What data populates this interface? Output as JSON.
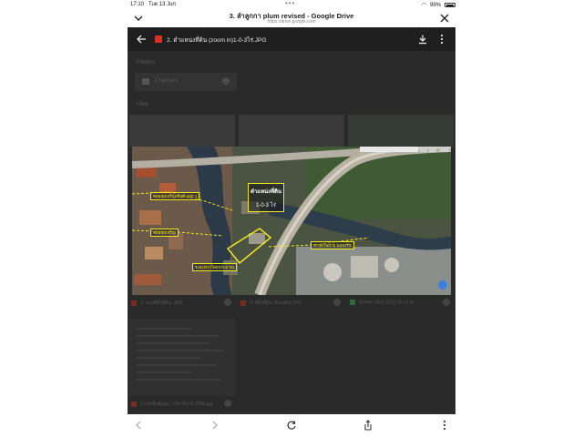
{
  "status_bar": {
    "time": "17:10",
    "date": "Tue 13 Jun",
    "battery": "99%"
  },
  "browser": {
    "title": "3. ลำลูกกา plum revised - Google Drive",
    "url": "https://drive.google.com"
  },
  "viewer": {
    "file_name": "2. ตำแหน่งที่ดิน (zoom in)1-0-3ไร่.JPG"
  },
  "background": {
    "folders_label": "Folders",
    "folder_name": "Channels",
    "files_label": "Files",
    "captions": [
      "1. แผนที่ตั้งที่ดิน .JPG",
      "2. ที่ตั้งที่ดิน (ซ้อนทับ) JPG",
      "Screen Shot 2023-06-15 at"
    ],
    "doc_caption": "3.หนังสือสัญญา 1ข้อ 20-06-2565.jpg"
  },
  "map": {
    "callout_title": "ตำแหน่งที่ดิน",
    "callout_area": "1-0-3 ไร่",
    "labels": [
      "ซอยลุ่มเจริญเซนต์ แยก 1",
      "ซอยลุ่มเจริญ",
      "ระยะทางโดยประมาณ",
      "ทางด่วนสาย ฉลองรัช"
    ]
  },
  "colors": {
    "drive_bg": "#2a2a2a",
    "accent_red": "#d93025",
    "highlight_yellow": "#f3e51e"
  }
}
